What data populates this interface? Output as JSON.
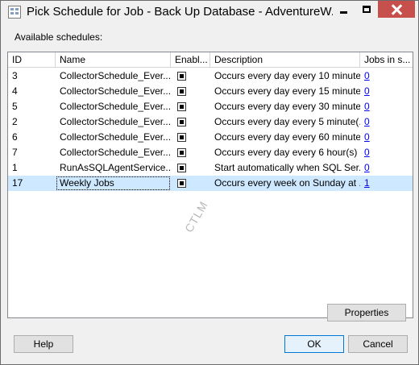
{
  "window": {
    "title": "Pick Schedule for Job - Back Up Database - AdventureW..."
  },
  "label": "Available schedules:",
  "table": {
    "columns": [
      "ID",
      "Name",
      "Enabl...",
      "Description",
      "Jobs in s..."
    ],
    "rows": [
      {
        "id": "3",
        "name": "CollectorSchedule_Ever...",
        "enabled": true,
        "description": "Occurs every day every 10 minute...",
        "jobs": "0"
      },
      {
        "id": "4",
        "name": "CollectorSchedule_Ever...",
        "enabled": true,
        "description": "Occurs every day every 15 minute...",
        "jobs": "0"
      },
      {
        "id": "5",
        "name": "CollectorSchedule_Ever...",
        "enabled": true,
        "description": "Occurs every day every 30 minute...",
        "jobs": "0"
      },
      {
        "id": "2",
        "name": "CollectorSchedule_Ever...",
        "enabled": true,
        "description": "Occurs every day every 5 minute(...",
        "jobs": "0"
      },
      {
        "id": "6",
        "name": "CollectorSchedule_Ever...",
        "enabled": true,
        "description": "Occurs every day every 60 minute...",
        "jobs": "0"
      },
      {
        "id": "7",
        "name": "CollectorSchedule_Ever...",
        "enabled": true,
        "description": "Occurs every day every 6 hour(s) ...",
        "jobs": "0"
      },
      {
        "id": "1",
        "name": "RunAsSQLAgentService...",
        "enabled": true,
        "description": "Start automatically when SQL Ser...",
        "jobs": "0"
      },
      {
        "id": "17",
        "name": "Weekly Jobs",
        "enabled": true,
        "description": "Occurs every week on Sunday at ...",
        "jobs": "1",
        "selected": true
      }
    ]
  },
  "watermark": "CTLM",
  "buttons": {
    "properties": "Properties",
    "help": "Help",
    "ok": "OK",
    "cancel": "Cancel"
  },
  "colors": {
    "selection": "#cde8ff",
    "close_button": "#c7504c",
    "link": "#0000ee"
  }
}
